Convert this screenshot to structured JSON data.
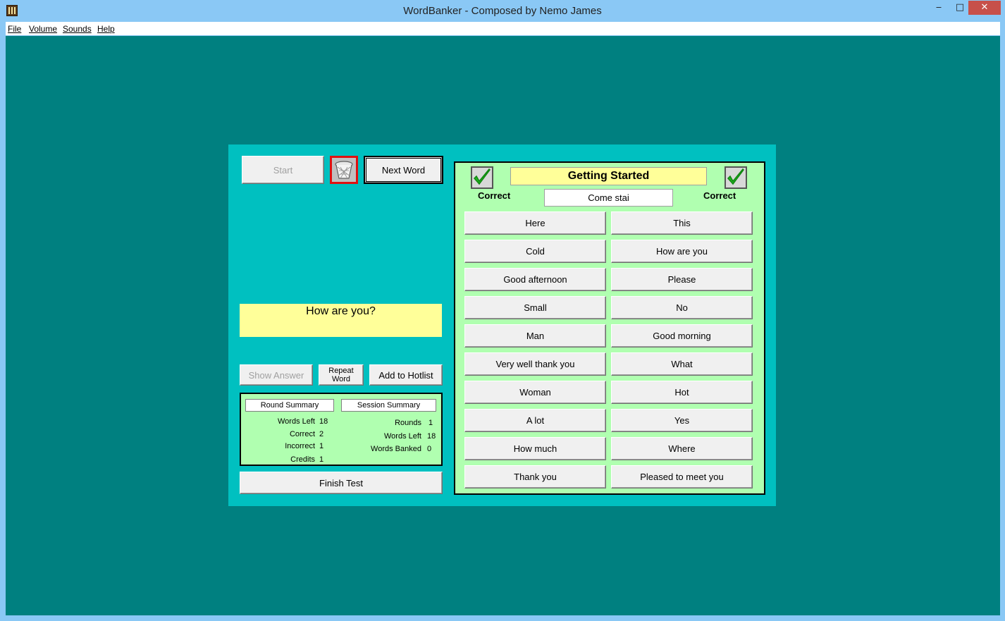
{
  "window": {
    "title": "WordBanker - Composed by Nemo James",
    "minimize": "‒",
    "maximize": "□",
    "close": "✕"
  },
  "menu": [
    "File",
    "Volume",
    "Sounds",
    "Help"
  ],
  "controls": {
    "start": "Start",
    "next_word": "Next Word",
    "basket_icon": "wastebasket-icon",
    "show_answer": "Show Answer",
    "repeat_word_line1": "Repeat",
    "repeat_word_line2": "Word",
    "add_to_hotlist": "Add to  Hotlist",
    "finish_test": "Finish Test"
  },
  "question": "How are you?",
  "round_summary": {
    "header": "Round Summary",
    "rows": [
      {
        "label": "Words Left",
        "value": "18"
      },
      {
        "label": "Correct",
        "value": "2"
      },
      {
        "label": "Incorrect",
        "value": "1"
      },
      {
        "label": "Credits",
        "value": "1"
      }
    ]
  },
  "session_summary": {
    "header": "Session Summary",
    "rows": [
      {
        "label": "Rounds",
        "value": "1"
      },
      {
        "label": "Words Left",
        "value": "18"
      },
      {
        "label": "Words Banked",
        "value": "0"
      }
    ]
  },
  "game": {
    "title": "Getting Started",
    "answer": "Come stai",
    "left_check_label": "Correct",
    "right_check_label": "Correct",
    "words_left": [
      "Here",
      "Cold",
      "Good afternoon",
      "Small",
      "Man",
      "Very well thank you",
      "Woman",
      "A lot",
      "How much",
      "Thank you"
    ],
    "words_right": [
      "This",
      "How are you",
      "Please",
      "No",
      "Good morning",
      "What",
      "Hot",
      "Yes",
      "Where",
      "Pleased to meet you"
    ]
  },
  "colors": {
    "client_bg": "#008080",
    "panel_bg": "#00c0c0",
    "highlight_yellow": "#ffff99",
    "light_green": "#b0ffb0",
    "check_green": "#22b422"
  }
}
